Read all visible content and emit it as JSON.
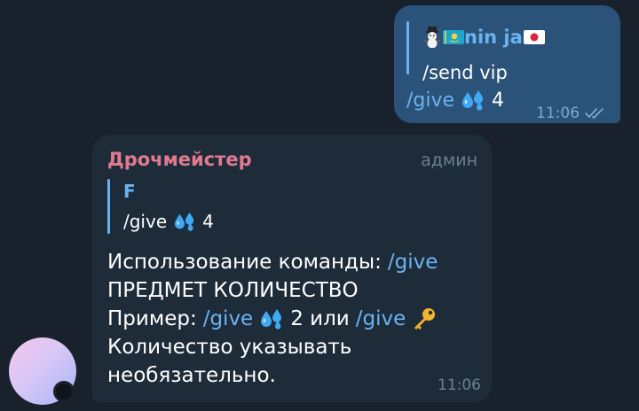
{
  "outgoing": {
    "quote_author": "nin ja",
    "quote_text": "/send vip",
    "message_command": "/give",
    "message_count": "4",
    "time": "11:06",
    "read_status": "double-check-icon"
  },
  "incoming": {
    "sender": "Дрочмейстер",
    "role": "админ",
    "quote_author": "F",
    "quote_command": "/give",
    "quote_count": "4",
    "body": {
      "line1_text": "Использование команды: ",
      "line1_cmd": "/give",
      "line2_text": "ПРЕДМЕТ КОЛИЧЕСТВО",
      "line3_prefix": "Пример: ",
      "line3_cmd1": "/give",
      "line3_count": "2 или",
      "line3_cmd2": "/give",
      "line4_text": "Количество указывать",
      "line5_text": "необязательно."
    },
    "time": "11:06"
  },
  "colors": {
    "background": "#18212c",
    "outgoing_bubble": "#2b5278",
    "incoming_bubble": "#1e2c3a",
    "link": "#6ab3f3",
    "sender_name": "#e17a8f"
  },
  "icons": [
    "snowman-icon",
    "kazakhstan-flag-icon",
    "japan-flag-icon",
    "droplets-icon",
    "key-icon",
    "double-check-icon"
  ]
}
